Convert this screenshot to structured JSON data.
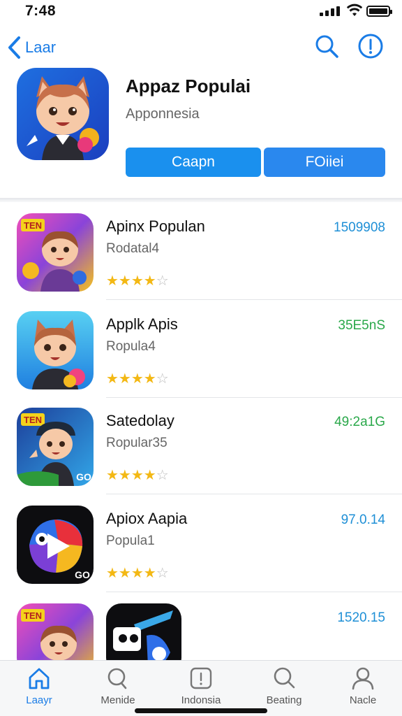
{
  "status_bar": {
    "time": "7:48"
  },
  "nav": {
    "back_label": "Laar",
    "back_icon": "chevron-left-icon",
    "search_icon": "search-icon",
    "info_icon": "info-icon",
    "accent": "#1a7ce6"
  },
  "hero": {
    "title": "Appaz Populai",
    "subtitle": "Apponnesia",
    "primary_button": "Caapn",
    "secondary_button": "FOiiei",
    "button_color": "#1a90ee"
  },
  "apps": [
    {
      "name": "Apinx Populan",
      "subtitle": "Rodatal4",
      "rating": 4,
      "value": "1509908",
      "value_color": "#1e8fd6",
      "badge": "TEN"
    },
    {
      "name": "Applk Apis",
      "subtitle": "Ropula4",
      "rating": 4,
      "value": "35E5nS",
      "value_color": "#2aa84a",
      "badge": ""
    },
    {
      "name": "Satedolay",
      "subtitle": "Ropular35",
      "rating": 4,
      "value": "49:2a1G",
      "value_color": "#2aa84a",
      "badge": "TEN",
      "corner": "GO"
    },
    {
      "name": "Apiox Aapia",
      "subtitle": "Popula1",
      "rating": 4,
      "value": "97.0.14",
      "value_color": "#1e8fd6",
      "badge": "",
      "corner": "GO"
    },
    {
      "name": "",
      "subtitle": "",
      "rating": 0,
      "value": "1520.15",
      "value_color": "#1e8fd6",
      "badge": "TEN"
    }
  ],
  "star_colors": {
    "filled": "#f3b814",
    "empty": "#bdbdbd"
  },
  "tabs": [
    {
      "label": "Laayr",
      "icon": "home-icon",
      "active": true
    },
    {
      "label": "Menide",
      "icon": "search-icon",
      "active": false
    },
    {
      "label": "Indonsia",
      "icon": "info-icon",
      "active": false
    },
    {
      "label": "Beating",
      "icon": "search-icon",
      "active": false
    },
    {
      "label": "Nacle",
      "icon": "person-icon",
      "active": false
    }
  ]
}
